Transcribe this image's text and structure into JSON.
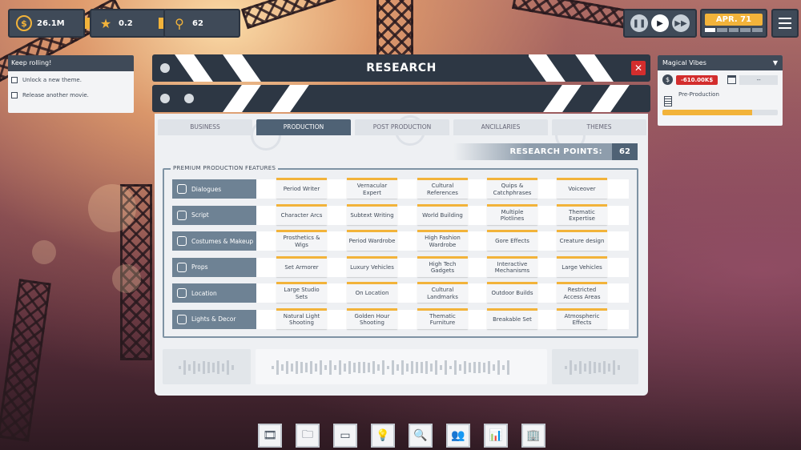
{
  "stats": {
    "money": "26.1M",
    "rating": "0.2",
    "research_points": "62"
  },
  "date": {
    "label": "APR. 71",
    "progress_segments": 5,
    "progress_filled": 1
  },
  "objectives": {
    "title": "Keep rolling!",
    "items": [
      {
        "label": "Unlock a new theme."
      },
      {
        "label": "Release another movie."
      }
    ]
  },
  "movie": {
    "title": "Magical Vibes",
    "budget": "-610.00K$",
    "release": "--",
    "stage": "Pre-Production",
    "stage_progress": 0.78
  },
  "research": {
    "title": "RESEARCH",
    "close_label": "✕",
    "tabs": [
      {
        "label": "BUSINESS",
        "active": false
      },
      {
        "label": "PRODUCTION",
        "active": true
      },
      {
        "label": "POST PRODUCTION",
        "active": false
      },
      {
        "label": "ANCILLARIES",
        "active": false
      },
      {
        "label": "THEMES",
        "active": false
      }
    ],
    "points_label": "RESEARCH POINTS:",
    "points_value": "62",
    "section_title": "PREMIUM PRODUCTION FEATURES",
    "categories": [
      {
        "label": "Dialogues",
        "icon": "pen-icon",
        "features": [
          "Period Writer",
          "Vernacular Expert",
          "Cultural References",
          "Quips & Catchphrases",
          "Voiceover"
        ]
      },
      {
        "label": "Script",
        "icon": "script-icon",
        "features": [
          "Character Arcs",
          "Subtext Writing",
          "World Building",
          "Multiple Plotlines",
          "Thematic Expertise"
        ]
      },
      {
        "label": "Costumes & Makeup",
        "icon": "costume-icon",
        "features": [
          "Prosthetics & Wigs",
          "Period Wardrobe",
          "High Fashion Wardrobe",
          "Gore Effects",
          "Creature design"
        ]
      },
      {
        "label": "Props",
        "icon": "props-icon",
        "features": [
          "Set Armorer",
          "Luxury Vehicles",
          "High Tech Gadgets",
          "Interactive Mechanisms",
          "Large Vehicles"
        ]
      },
      {
        "label": "Location",
        "icon": "location-icon",
        "features": [
          "Large Studio Sets",
          "On Location",
          "Cultural Landmarks",
          "Outdoor Builds",
          "Restricted Access Areas"
        ]
      },
      {
        "label": "Lights & Decor",
        "icon": "lights-icon",
        "features": [
          "Natural Light Shooting",
          "Golden Hour Shooting",
          "Thematic Furniture",
          "Breakable Set",
          "Atmospheric Effects"
        ]
      }
    ]
  },
  "toolbar": [
    {
      "name": "film-icon",
      "glyph": "🎞"
    },
    {
      "name": "folder-icon",
      "glyph": "🗀"
    },
    {
      "name": "screen-icon",
      "glyph": "▭"
    },
    {
      "name": "lightbulb-icon",
      "glyph": "💡"
    },
    {
      "name": "research-icon",
      "glyph": "🔍",
      "active": true
    },
    {
      "name": "people-icon",
      "glyph": "👥"
    },
    {
      "name": "stats-icon",
      "glyph": "📊"
    },
    {
      "name": "building-icon",
      "glyph": "🏢"
    }
  ],
  "colors": {
    "accent": "#f2b33a",
    "panel_dark": "#3f4a58",
    "tab_active": "#4f6275",
    "danger": "#d32d2d"
  }
}
